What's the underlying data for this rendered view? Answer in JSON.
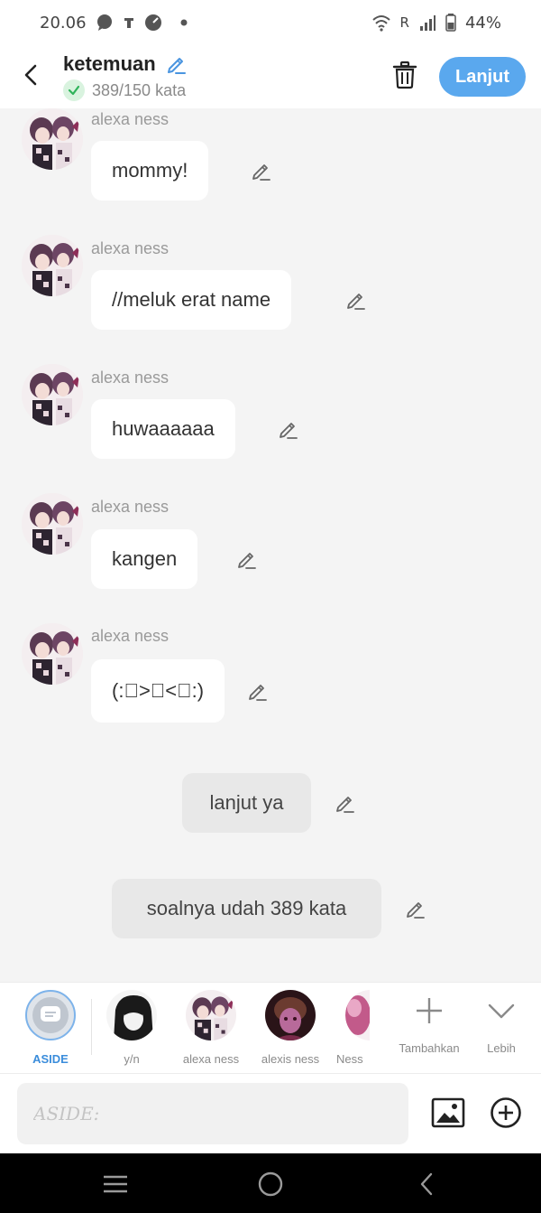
{
  "status_bar": {
    "time": "20.06",
    "network": "R",
    "battery": "44%"
  },
  "header": {
    "title": "ketemuan",
    "word_count": "389/150 kata",
    "next_label": "Lanjut"
  },
  "messages": [
    {
      "sender": "alexa ness",
      "text": "mommy!"
    },
    {
      "sender": "alexa ness",
      "text": "//meluk erat name"
    },
    {
      "sender": "alexa ness",
      "text": "huwaaaaaa"
    },
    {
      "sender": "alexa ness",
      "text": "kangen"
    },
    {
      "sender": "alexa ness",
      "text": "(:ﾟ>︿<ﾟ:)"
    }
  ],
  "narrations": [
    {
      "text": "lanjut ya"
    },
    {
      "text": "soalnya udah 389 kata"
    }
  ],
  "characters": [
    {
      "name": "ASIDE",
      "selected": true
    },
    {
      "name": "y/n"
    },
    {
      "name": "alexa ness"
    },
    {
      "name": "alexis ness"
    },
    {
      "name": "Ness"
    }
  ],
  "tools": {
    "add_label": "Tambahkan",
    "more_label": "Lebih"
  },
  "input": {
    "placeholder": "ASIDE:"
  },
  "colors": {
    "accent": "#5aa8ee",
    "aside_accent": "#3b8ddb",
    "bubble": "#ffffff",
    "narration": "#e8e8e8",
    "background": "#f4f4f4"
  },
  "icons": [
    "message-icon",
    "notification-icon",
    "speed-icon",
    "wifi-icon",
    "signal-icon",
    "battery-icon",
    "back-icon",
    "edit-icon",
    "check-icon",
    "trash-icon",
    "plus-icon",
    "chevron-down-icon",
    "image-icon",
    "add-circle-icon",
    "menu-icon",
    "home-icon",
    "nav-back-icon"
  ]
}
